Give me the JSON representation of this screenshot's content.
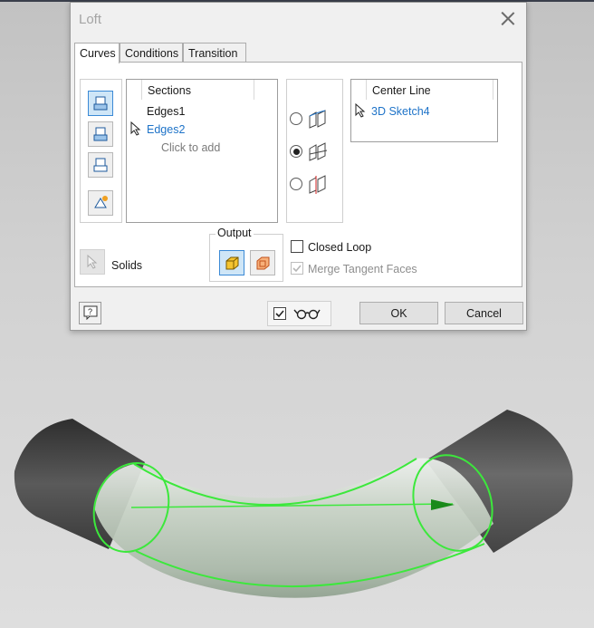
{
  "dialog": {
    "title": "Loft",
    "tabs": [
      {
        "label": "Curves",
        "active": true
      },
      {
        "label": "Conditions",
        "active": false
      },
      {
        "label": "Transition",
        "active": false
      }
    ],
    "sections": {
      "header": "Sections",
      "items": [
        {
          "label": "Edges1",
          "state": "normal"
        },
        {
          "label": "Edges2",
          "state": "highlighted"
        },
        {
          "label": "Click to add",
          "state": "placeholder"
        }
      ]
    },
    "loft_type": {
      "options": [
        "rails-icon",
        "center-line-icon",
        "area-loft-icon"
      ],
      "selected_index": 1
    },
    "center_line": {
      "header": "Center Line",
      "items": [
        {
          "label": "3D Sketch4",
          "state": "highlighted"
        }
      ]
    },
    "output": {
      "legend": "Output",
      "options": [
        "solid-output-icon",
        "surface-output-icon"
      ],
      "selected_index": 0
    },
    "solids_label": "Solids",
    "closed_loop": {
      "label": "Closed Loop",
      "checked": false,
      "enabled": true
    },
    "merge_tangent": {
      "label": "Merge Tangent Faces",
      "checked": true,
      "enabled": false
    },
    "footer": {
      "preview_checked": true,
      "ok_label": "OK",
      "cancel_label": "Cancel"
    }
  },
  "colors": {
    "accent_blue": "#1e73c8",
    "selection_green": "#3ce83c",
    "tube_dark": "#555555"
  }
}
